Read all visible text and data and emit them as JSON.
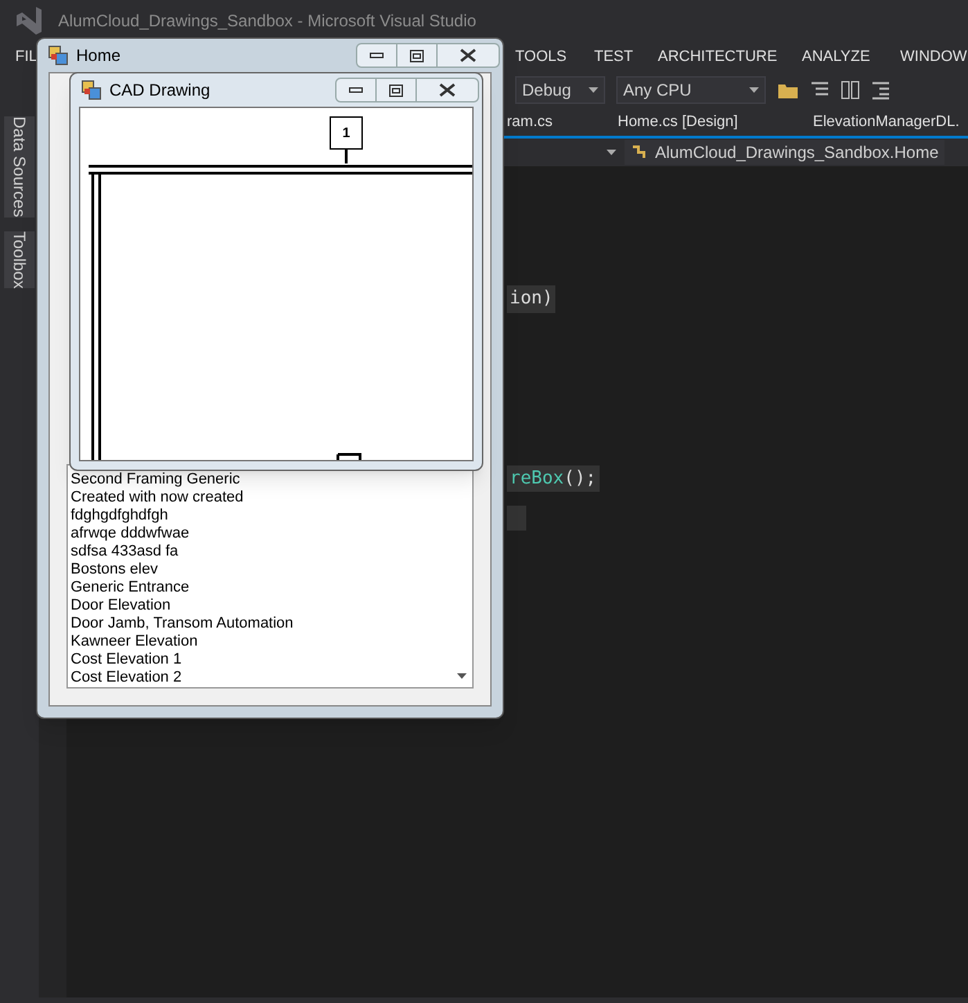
{
  "ide": {
    "title": "AlumCloud_Drawings_Sandbox - Microsoft Visual Studio",
    "menu": [
      "FIL",
      "TOOLS",
      "TEST",
      "ARCHITECTURE",
      "ANALYZE",
      "WINDOW"
    ],
    "toolbar": {
      "configuration": "Debug",
      "platform": "Any CPU"
    },
    "side_tabs": [
      "Data Sources",
      "Toolbox"
    ],
    "doc_tabs": [
      "ram.cs",
      "Home.cs [Design]",
      "ElevationManagerDL."
    ],
    "nav_class": "AlumCloud_Drawings_Sandbox.Home",
    "code_lines": [
      {
        "kind": "plain",
        "text": "ion)"
      },
      {
        "kind": "call",
        "name": "reBox",
        "rest": "();"
      },
      {
        "kind": "blank"
      }
    ]
  },
  "home_window": {
    "title": "Home",
    "list_items": [
      "Second Framing Generic",
      "Created with now created",
      "fdghgdfghdfgh",
      "afrwqe dddwfwae",
      "sdfsa 433asd fa",
      "Bostons elev",
      "Generic Entrance",
      "Door Elevation",
      "Door Jamb, Transom Automation",
      "Kawneer Elevation",
      "Cost Elevation 1",
      "Cost Elevation 2"
    ]
  },
  "cad_window": {
    "title": "CAD Drawing",
    "drawing_label": "1"
  }
}
